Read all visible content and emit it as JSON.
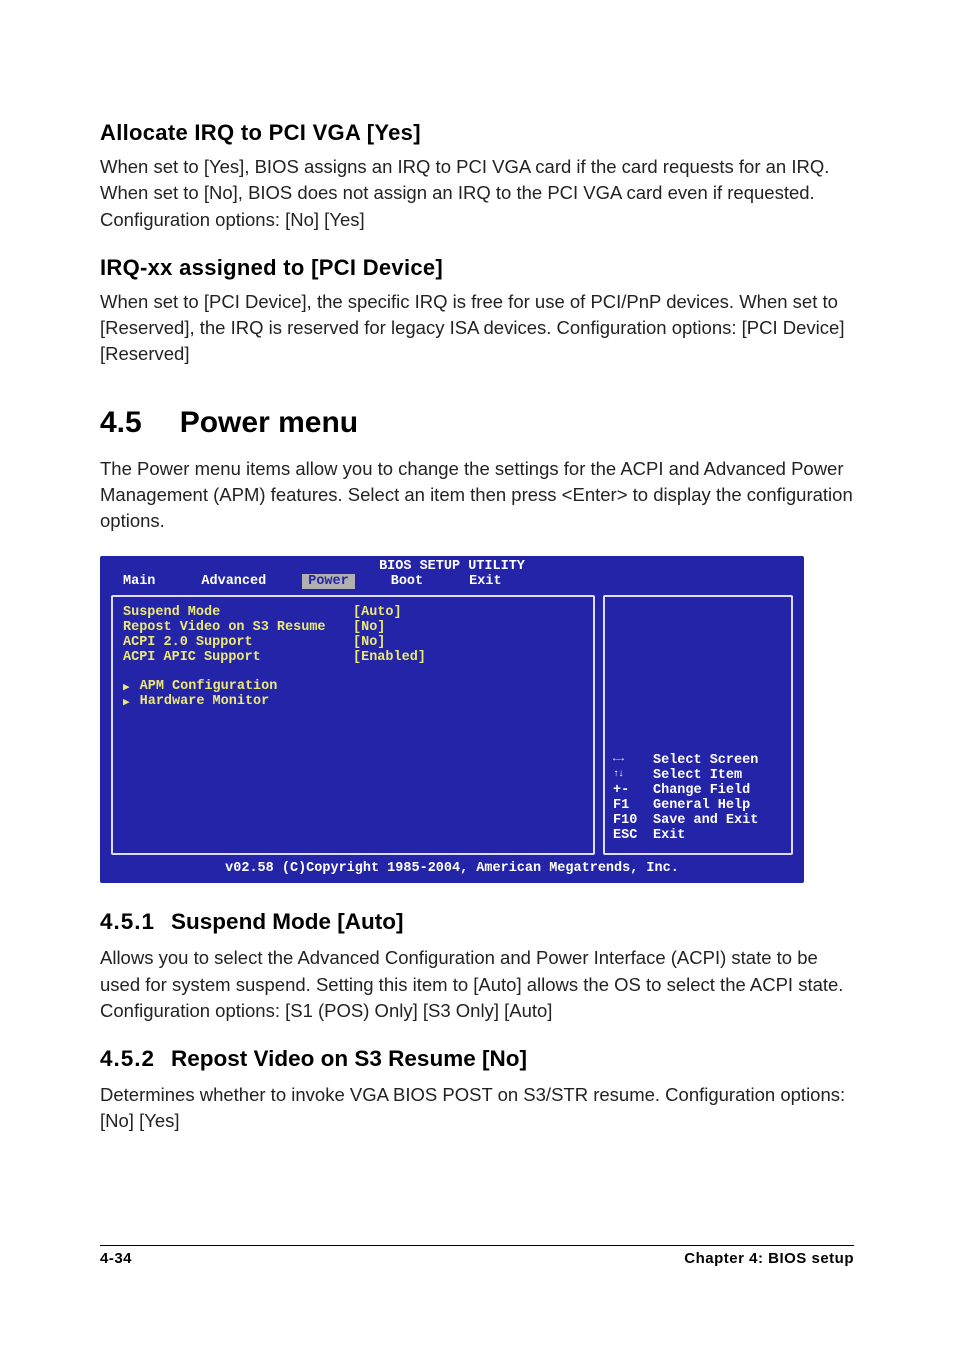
{
  "section1": {
    "heading": "Allocate IRQ to PCI VGA [Yes]",
    "body": "When set to [Yes], BIOS assigns an IRQ to PCI VGA card if the card requests for an IRQ. When set to [No], BIOS does not assign an IRQ to the PCI VGA card even if requested. Configuration options: [No] [Yes]"
  },
  "section2": {
    "heading": "IRQ-xx assigned to [PCI Device]",
    "body": "When set to [PCI Device], the specific IRQ is free for use of PCI/PnP devices. When set to [Reserved], the IRQ is reserved for legacy ISA devices. Configuration options: [PCI Device] [Reserved]"
  },
  "major": {
    "num": "4.5",
    "title": "Power menu",
    "intro": "The Power menu items allow you to change the settings for the ACPI and Advanced Power Management (APM) features. Select an item then press <Enter> to display the configuration options."
  },
  "bios": {
    "title": "BIOS SETUP UTILITY",
    "tabs": [
      "Main",
      "Advanced",
      "Power",
      "Boot",
      "Exit"
    ],
    "active_tab": "Power",
    "items": [
      {
        "label": "Suspend Mode",
        "value": "[Auto]"
      },
      {
        "label": "Repost Video on S3 Resume",
        "value": "[No]"
      },
      {
        "label": "ACPI 2.0 Support",
        "value": "[No]"
      },
      {
        "label": "ACPI APIC Support",
        "value": "[Enabled]"
      }
    ],
    "submenus": [
      "APM Configuration",
      "Hardware Monitor"
    ],
    "help": [
      {
        "key_icon": "↔",
        "text": "Select Screen"
      },
      {
        "key_icon": "↕",
        "text": "Select Item"
      },
      {
        "key": "+-",
        "text": "Change Field"
      },
      {
        "key": "F1",
        "text": "General Help"
      },
      {
        "key": "F10",
        "text": "Save and Exit"
      },
      {
        "key": "ESC",
        "text": "Exit"
      }
    ],
    "footer": "v02.58 (C)Copyright 1985-2004, American Megatrends, Inc."
  },
  "sub1": {
    "num": "4.5.1",
    "title": "Suspend Mode [Auto]",
    "body": "Allows you to select the Advanced Configuration and Power Interface (ACPI) state to be used for system suspend. Setting this item to [Auto] allows the OS to select the ACPI state. Configuration options: [S1 (POS) Only] [S3 Only] [Auto]"
  },
  "sub2": {
    "num": "4.5.2",
    "title": "Repost Video on S3 Resume [No]",
    "body": "Determines whether to invoke VGA BIOS POST on S3/STR resume. Configuration options: [No] [Yes]"
  },
  "footer": {
    "left": "4-34",
    "right": "Chapter 4: BIOS setup"
  }
}
